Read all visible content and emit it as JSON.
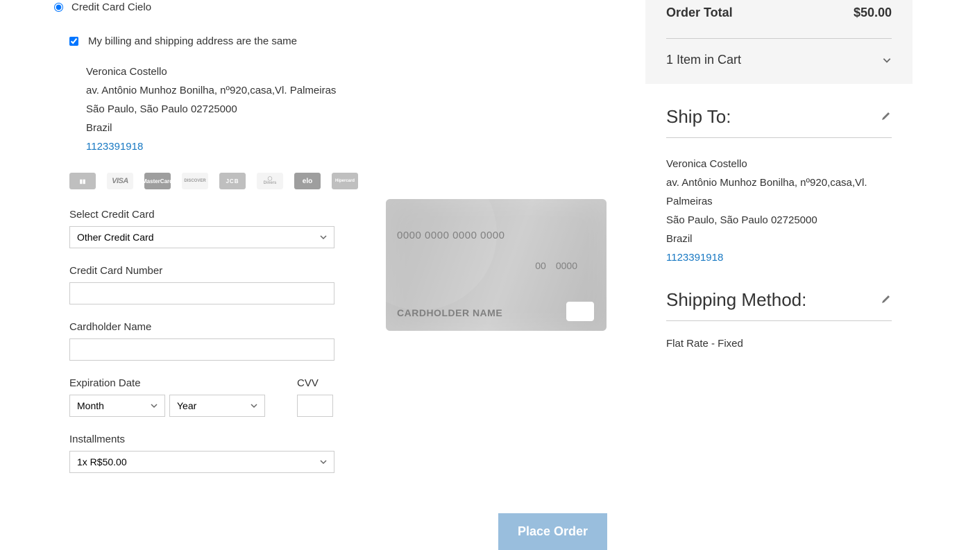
{
  "payment": {
    "method_label": "Credit Card Cielo",
    "billing_same_label": "My billing and shipping address are the same"
  },
  "billing_address": {
    "name": "Veronica Costello",
    "street": "av. Antônio Munhoz Bonilha, nº920,casa,Vl. Palmeiras",
    "city": "São Paulo, São Paulo 02725000",
    "country": "Brazil",
    "phone": "1123391918"
  },
  "card_brands": [
    "amex",
    "visa",
    "mastercard",
    "discover",
    "jcb",
    "diners",
    "elo",
    "hipercard"
  ],
  "form": {
    "select_card_label": "Select Credit Card",
    "select_card_value": "Other Credit Card",
    "cc_number_label": "Credit Card Number",
    "cc_number_value": "",
    "cardholder_label": "Cardholder Name",
    "cardholder_value": "",
    "exp_label": "Expiration Date",
    "exp_month": "Month",
    "exp_year": "Year",
    "cvv_label": "CVV",
    "cvv_value": "",
    "installments_label": "Installments",
    "installments_value": "1x R$50.00"
  },
  "card_preview": {
    "number": "0000 0000 0000 0000",
    "exp_mm": "00",
    "exp_yyyy": "0000",
    "name": "CARDHOLDER NAME"
  },
  "place_order_label": "Place Order",
  "summary": {
    "order_total_label": "Order Total",
    "order_total_value": "$50.00",
    "cart_items_label": "1 Item in Cart"
  },
  "ship_to": {
    "heading": "Ship To:",
    "name": "Veronica Costello",
    "street": "av. Antônio Munhoz Bonilha, nº920,casa,Vl. Palmeiras",
    "city": "São Paulo, São Paulo 02725000",
    "country": "Brazil",
    "phone": "1123391918"
  },
  "shipping_method": {
    "heading": "Shipping Method:",
    "value": "Flat Rate - Fixed"
  }
}
